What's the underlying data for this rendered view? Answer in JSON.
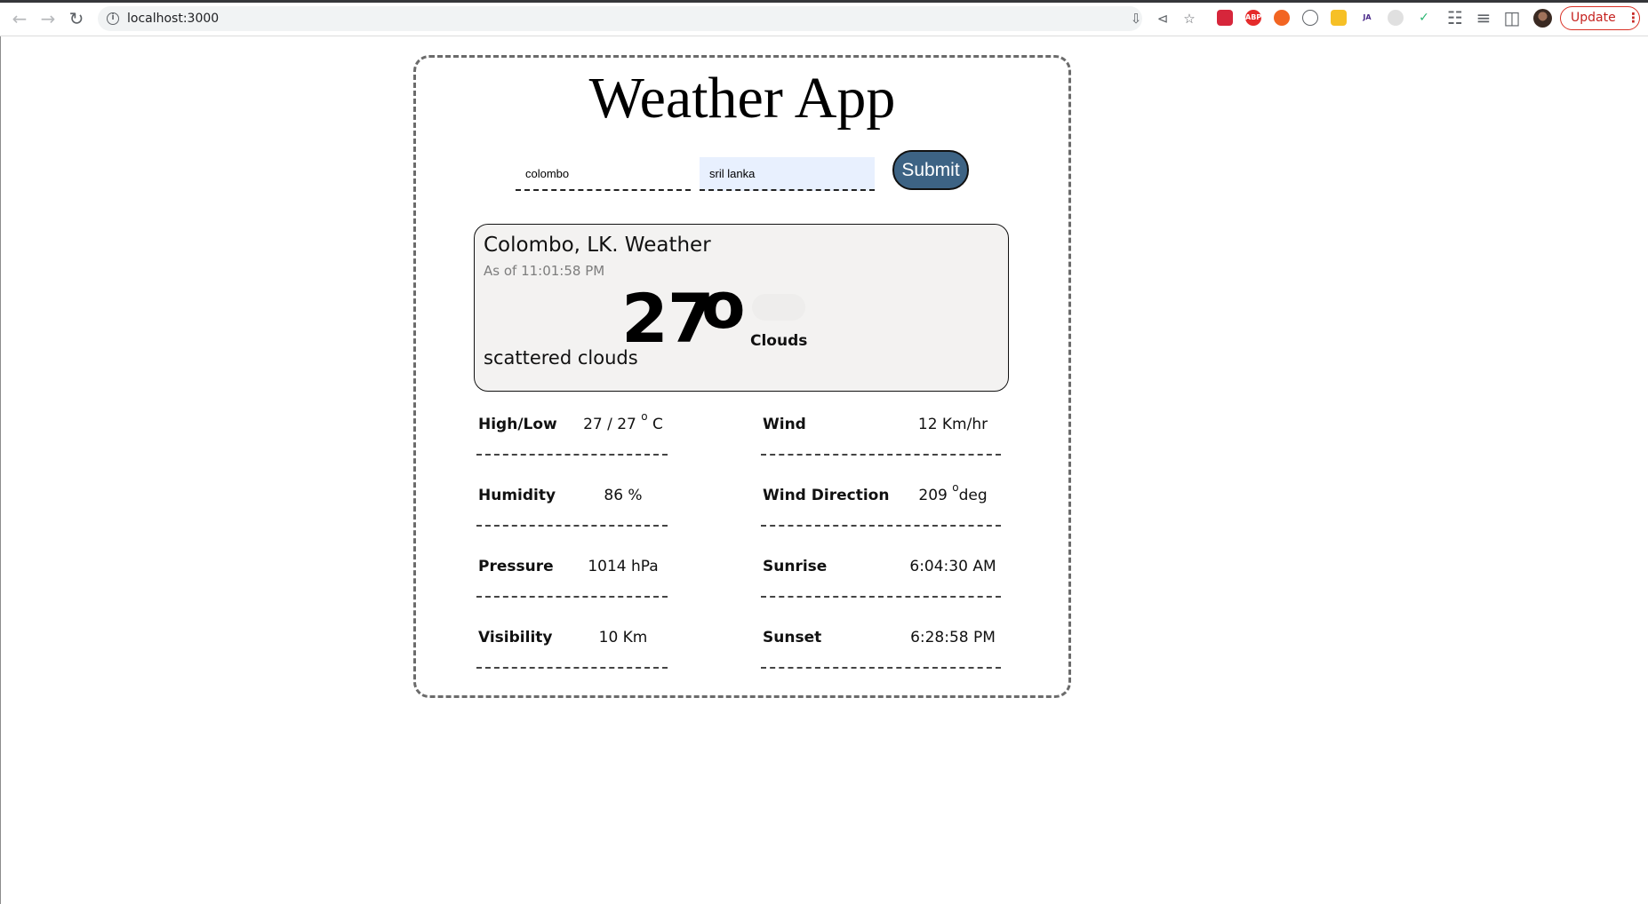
{
  "browser": {
    "url": "localhost:3000",
    "update_label": "Update",
    "icons": [
      "back-arrow-icon",
      "forward-arrow-icon",
      "reload-icon",
      "info-icon",
      "install-icon",
      "share-icon",
      "bookmark-star-icon",
      "extensions-puzzle-icon",
      "reading-list-icon",
      "side-panel-icon",
      "menu-kebab-icon"
    ],
    "extension_badges": [
      "",
      "ABP",
      "",
      "",
      "",
      "JA",
      "",
      ""
    ]
  },
  "app": {
    "title": "Weather App",
    "city_value": "colombo",
    "country_value": "sril lanka",
    "submit_label": "Submit"
  },
  "current": {
    "location_title": "Colombo, LK. Weather",
    "as_of": "As of 11:01:58 PM",
    "temperature": "27",
    "degree_symbol": "o",
    "conditions": "Clouds",
    "description": "scattered clouds"
  },
  "stats_left": [
    {
      "label": "High/Low",
      "value": "27 / 27",
      "sup": "o",
      "suffix": " C"
    },
    {
      "label": "Humidity",
      "value": "86 %"
    },
    {
      "label": "Pressure",
      "value": "1014 hPa"
    },
    {
      "label": "Visibility",
      "value": "10 Km"
    }
  ],
  "stats_right": [
    {
      "label": "Wind",
      "value": "12 Km/hr"
    },
    {
      "label": "Wind Direction",
      "value": "209 ",
      "sup": "o",
      "suffix": "deg"
    },
    {
      "label": "Sunrise",
      "value": "6:04:30 AM"
    },
    {
      "label": "Sunset",
      "value": "6:28:58 PM"
    }
  ]
}
